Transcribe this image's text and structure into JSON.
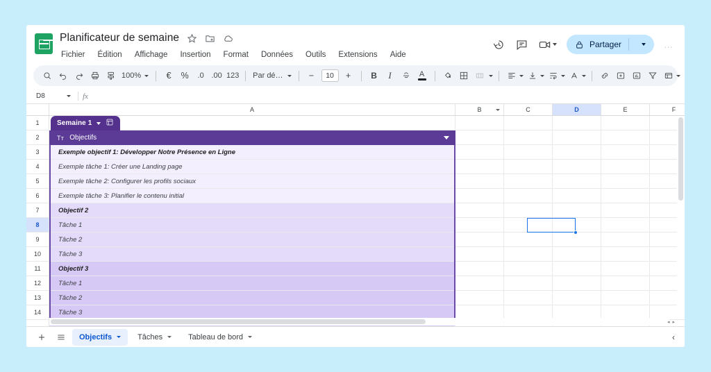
{
  "app": {
    "logo_icon": "sheets-logo-icon",
    "doc_title": "Planificateur de semaine",
    "title_icons": [
      {
        "name": "star-icon"
      },
      {
        "name": "move-to-folder-icon"
      },
      {
        "name": "cloud-saved-icon"
      }
    ],
    "menu": [
      "Fichier",
      "Édition",
      "Affichage",
      "Insertion",
      "Format",
      "Données",
      "Outils",
      "Extensions",
      "Aide"
    ],
    "actions": {
      "history_icon": "version-history-icon",
      "comment_icon": "comment-icon",
      "meet_icon": "meet-camera-icon",
      "share_label": "Partager",
      "share_lock_icon": "lock-icon",
      "avatar_placeholder": "…"
    }
  },
  "toolbar": {
    "zoom": "100%",
    "font": "Par dé…",
    "font_size": "10",
    "decrease_label": "−",
    "increase_label": "+",
    "currency": "€",
    "percent": "%",
    "decimal_decrease": ".0",
    "decimal_increase": ".00",
    "number_format": "123",
    "bold": "B",
    "italic": "I",
    "strikethrough": "S",
    "text_color": "A",
    "items": [
      "search-icon",
      "undo-icon",
      "redo-icon",
      "print-icon",
      "paint-format-icon",
      "fill-color-icon",
      "borders-icon",
      "merge-cells-icon",
      "horizontal-align-icon",
      "vertical-align-icon",
      "text-wrap-icon",
      "text-rotation-icon",
      "insert-link-icon",
      "insert-comment-icon",
      "insert-chart-icon",
      "filter-icon",
      "functions-icon",
      "sum-icon",
      "collapse-toolbar-icon"
    ]
  },
  "formula_bar": {
    "name_box": "D8",
    "fx_label": "fx",
    "formula_value": ""
  },
  "grid": {
    "columns": [
      "A",
      "B",
      "C",
      "D",
      "E",
      "F"
    ],
    "selected_column": "D",
    "selected_cell": "D8",
    "selected_row": "8",
    "rows": [
      {
        "num": "1",
        "a": "",
        "style": ""
      },
      {
        "num": "2",
        "a": "",
        "style": ""
      },
      {
        "num": "3",
        "a": "Exemple objectif  1: Développer Notre Présence en Ligne",
        "style": "goal lv1"
      },
      {
        "num": "4",
        "a": "Exemple tâche 1: Créer une Landing page",
        "style": "task lv1"
      },
      {
        "num": "5",
        "a": "Exemple tâche 2: Configurer les profils sociaux",
        "style": "task lv1"
      },
      {
        "num": "6",
        "a": "Exemple tâche 3: Planifier le contenu initial",
        "style": "task lv1"
      },
      {
        "num": "7",
        "a": "Objectif 2",
        "style": "goal lv2"
      },
      {
        "num": "8",
        "a": "Tâche 1",
        "style": "task lv2"
      },
      {
        "num": "9",
        "a": "Tâche 2",
        "style": "task lv2"
      },
      {
        "num": "10",
        "a": "Tâche 3",
        "style": "task lv2"
      },
      {
        "num": "11",
        "a": "Objectif 3",
        "style": "goal lv3"
      },
      {
        "num": "12",
        "a": "Tâche 1",
        "style": "task lv3"
      },
      {
        "num": "13",
        "a": "Tâche 2",
        "style": "task lv3"
      },
      {
        "num": "14",
        "a": "Tâche 3",
        "style": "task lv3"
      }
    ]
  },
  "table_card": {
    "tab_name": "Semaine 1",
    "tab_icon": "table-view-icon",
    "column_type_label": "Tᴛ",
    "column_title": "Objectifs",
    "menu_icon": "chevron-down-icon"
  },
  "sheet_bar": {
    "add_icon": "add-sheet-icon",
    "all_sheets_icon": "all-sheets-icon",
    "tabs": [
      {
        "label": "Objectifs",
        "active": true
      },
      {
        "label": "Tâches",
        "active": false
      },
      {
        "label": "Tableau de bord",
        "active": false
      }
    ],
    "collapse_label": "‹"
  },
  "colors": {
    "page_background": "#c8eefb",
    "accent_purple": "#5b3b96",
    "tab_purple": "#54318c",
    "band_light": "#f4efff",
    "band_mid": "#e4dbfa",
    "band_dark": "#d7c9f5",
    "selection_blue": "#1a73e8",
    "share_blue": "#c2e7ff",
    "active_tab_blue": "#e8f0fe"
  }
}
